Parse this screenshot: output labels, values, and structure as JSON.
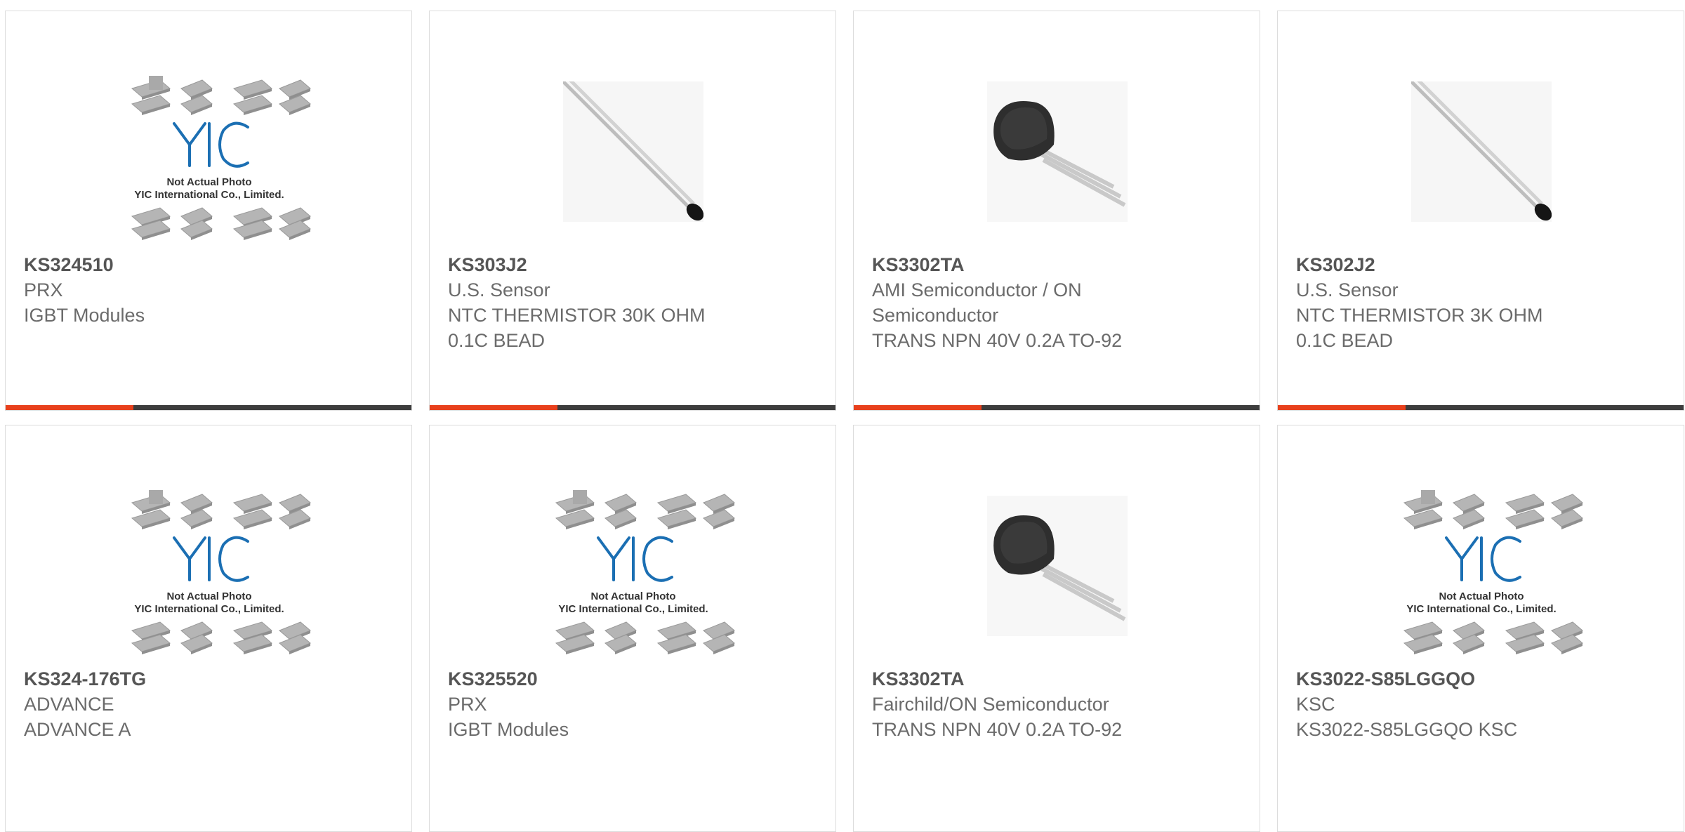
{
  "theme": {
    "accent": "#e8401c",
    "bar": "#3d3d3d",
    "text": "#6b6b6b",
    "border": "#dcdcdc"
  },
  "placeholder_image": {
    "line1": "Not Actual Photo",
    "line2": "YIC International Co., Limited.",
    "logo": "YIC"
  },
  "products": [
    {
      "part": "KS324510",
      "maker": "PRX",
      "desc": "IGBT Modules",
      "image": "placeholder-chips"
    },
    {
      "part": "KS303J2",
      "maker": "U.S. Sensor",
      "desc": "NTC THERMISTOR 30K OHM 0.1C BEAD",
      "image": "thermistor-bead"
    },
    {
      "part": "KS3302TA",
      "maker": "AMI Semiconductor / ON Semiconductor",
      "desc": "TRANS NPN 40V 0.2A TO-92",
      "image": "to92-transistor"
    },
    {
      "part": "KS302J2",
      "maker": "U.S. Sensor",
      "desc": "NTC THERMISTOR 3K OHM 0.1C BEAD",
      "image": "thermistor-bead"
    },
    {
      "part": "KS324-176TG",
      "maker": "ADVANCE",
      "desc": "ADVANCE A",
      "image": "placeholder-chips"
    },
    {
      "part": "KS325520",
      "maker": "PRX",
      "desc": "IGBT Modules",
      "image": "placeholder-chips"
    },
    {
      "part": "KS3302TA",
      "maker": "Fairchild/ON Semiconductor",
      "desc": "TRANS NPN 40V 0.2A TO-92",
      "image": "to92-transistor"
    },
    {
      "part": "KS3022-S85LGGQO",
      "maker": "KSC",
      "desc": "KS3022-S85LGGQO KSC",
      "image": "placeholder-chips"
    }
  ]
}
